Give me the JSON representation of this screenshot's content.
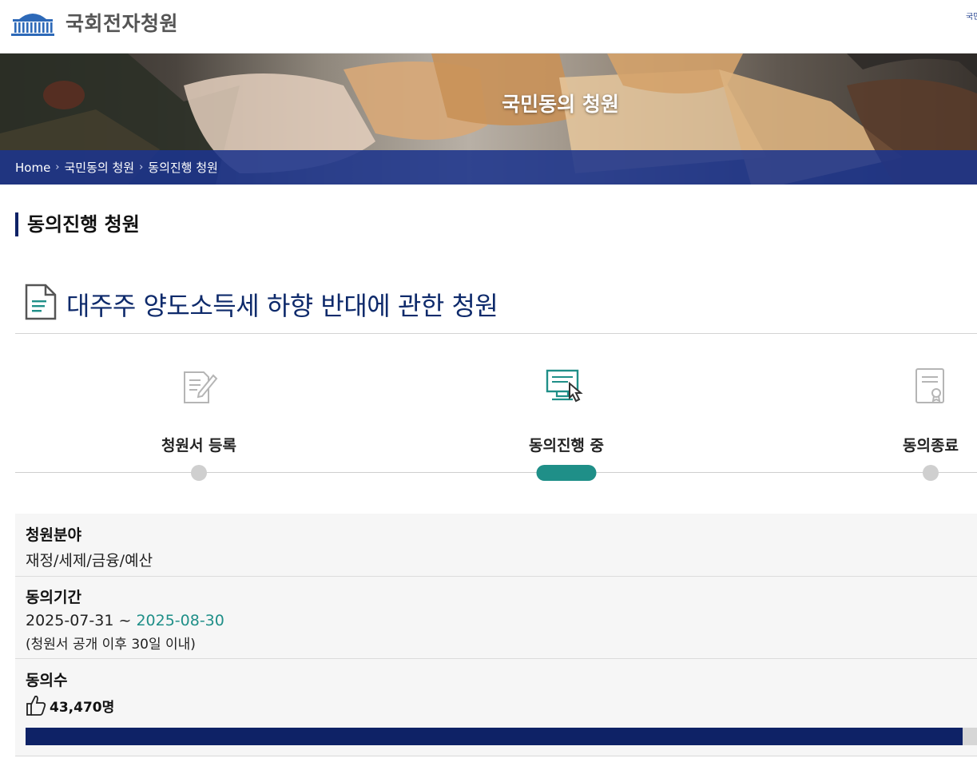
{
  "header": {
    "logo_text": "국회전자청원",
    "right_link": "국민 미래"
  },
  "banner": {
    "title": "국민동의 청원"
  },
  "breadcrumb": {
    "items": [
      "Home",
      "국민동의 청원",
      "동의진행 청원"
    ]
  },
  "page_title": "동의진행 청원",
  "petition": {
    "title": "대주주 양도소득세 하향 반대에 관한 청원"
  },
  "steps": [
    {
      "label": "청원서 등록",
      "icon": "pencil-document-icon",
      "active": false
    },
    {
      "label": "동의진행 중",
      "icon": "monitor-click-icon",
      "active": true
    },
    {
      "label": "동의종료",
      "icon": "certificate-icon",
      "active": false
    }
  ],
  "info": {
    "field_label": "청원분야",
    "field_value": "재정/세제/금융/예산",
    "period_label": "동의기간",
    "period_start": "2025-07-31",
    "period_sep": "~",
    "period_end": "2025-08-30",
    "period_note": "(청원서 공개 이후 30일 이내)",
    "count_label": "동의수",
    "count_value": "43,470명",
    "progress_fraction": 0.985
  },
  "colors": {
    "navy": "#0e2266",
    "teal": "#1f8f88",
    "breadcrumb_bg": "#1c348c"
  }
}
